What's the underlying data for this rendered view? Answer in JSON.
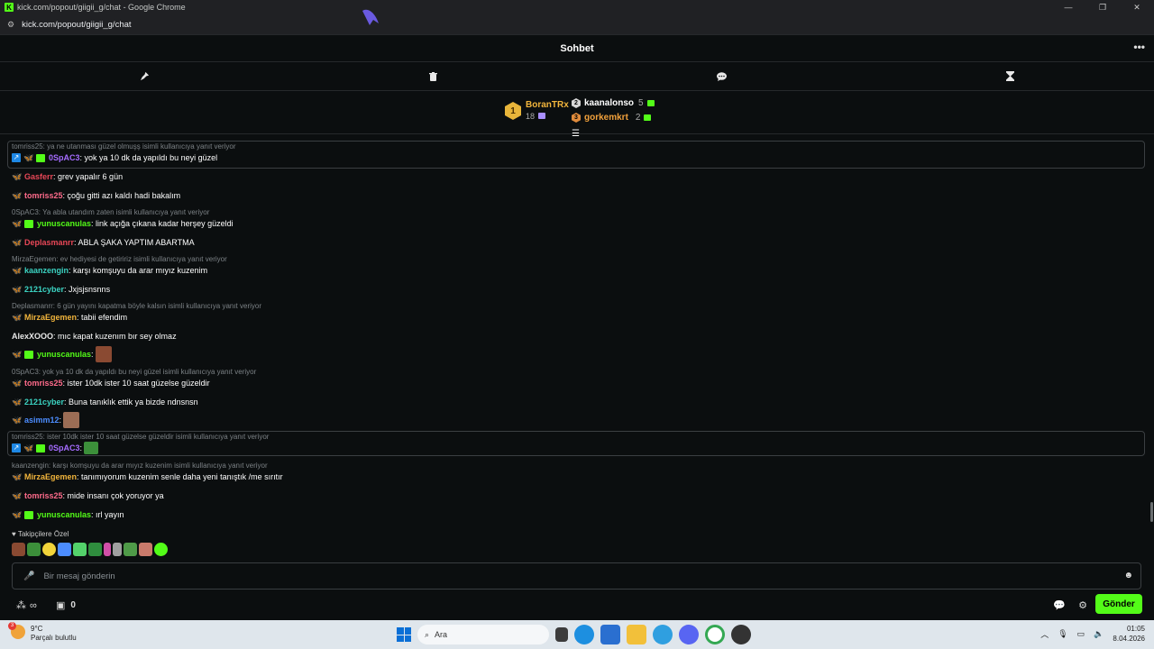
{
  "browser": {
    "title": "kick.com/popout/giigii_g/chat - Google Chrome",
    "url": "kick.com/popout/giigii_g/chat",
    "favicon": "K"
  },
  "header": {
    "title": "Sohbet",
    "menu": "•••"
  },
  "toolbar": {
    "icons": [
      "pin-icon",
      "trash-icon",
      "chat-bubble-icon",
      "hourglass-icon"
    ]
  },
  "leaderboard": {
    "first": {
      "rank": "1",
      "name": "BoranTRx",
      "count": "18"
    },
    "second": {
      "rank": "2",
      "name": "kaanalonso",
      "count": "5"
    },
    "third": {
      "rank": "3",
      "name": "gorkemkrt",
      "count": "2"
    }
  },
  "chat": {
    "r1": "tomriss25: ya ne utanması güzel olmuşş isimli kullanıcıya yanıt veriyor",
    "m1_user": "0SpAC3",
    "m1_text": ": yok ya 10 dk da yapıldı bu neyi güzel",
    "m2_user": "Gasferr",
    "m2_text": ": grev yapalır 6 gün",
    "m3_user": "tomriss25",
    "m3_text": ": çoğu gitti azı kaldı hadi bakalım",
    "r4": "0SpAC3: Ya abla utandım zaten isimli kullanıcıya yanıt veriyor",
    "m4_user": "yunuscanulas",
    "m4_text": ": link açığa çıkana kadar herşey güzeldi",
    "m5_user": "Deplasmanrr",
    "m5_text": ": ABLA ŞAKA YAPTIM ABARTMA",
    "r6": "MirzaEgemen: ev hediyesi de getiririz isimli kullanıcıya yanıt veriyor",
    "m6_user": "kaanzengin",
    "m6_text": ": karşı komşuyu da arar mıyız kuzenim",
    "m7_user": "2121cyber",
    "m7_text": ": Jxjsjsnsnns",
    "r8": "Deplasmanrr: 6 gün yayını kapatma böyle kalsın isimli kullanıcıya yanıt veriyor",
    "m8_user": "MirzaEgemen",
    "m8_text": ": tabii efendim",
    "m9_user": "AlexXOOO",
    "m9_text": ": mıc kapat kuzenım bır sey olmaz",
    "m10_user": "yunuscanulas",
    "m10_text": ":",
    "r11": "0SpAC3: yok ya 10 dk da yapıldı bu neyi güzel isimli kullanıcıya yanıt veriyor",
    "m11_user": "tomriss25",
    "m11_text": ": ister 10dk ister 10 saat güzelse güzeldir",
    "m12_user": "2121cyber",
    "m12_text": ": Buna tanıklık ettik ya bizde ndnsnsn",
    "m13_user": "asimm12",
    "m13_text": ":",
    "r14": "tomriss25: ister 10dk ister 10 saat güzelse güzeldir isimli kullanıcıya yanıt veriyor",
    "m14_user": "0SpAC3",
    "m14_text": ":",
    "r15": "kaanzengin: karşı komşuyu da arar mıyız kuzenim isimli kullanıcıya yanıt veriyor",
    "m15_user": "MirzaEgemen",
    "m15_text": ": tanımıyorum kuzenim senle daha yeni tanıştık /me sırıtır",
    "m16_user": "tomriss25",
    "m16_text": ": mide insanı çok yoruyor ya",
    "m17_user": "yunuscanulas",
    "m17_text": ": ırl yayın"
  },
  "emote_bar": {
    "label": "Takipçilere Özel",
    "count": 12
  },
  "input": {
    "placeholder": "Bir mesaj gönderin"
  },
  "footer": {
    "points": "0",
    "send_label": "Gönder",
    "infinity": "∞"
  },
  "taskbar": {
    "weather_temp": "9°C",
    "weather_desc": "Parçalı bulutlu",
    "weather_badge": "3",
    "search": "Ara",
    "time": "01:05",
    "date": "8.04.2026"
  },
  "colors": {
    "accent": "#53fc18",
    "background": "#0b0e0f"
  }
}
